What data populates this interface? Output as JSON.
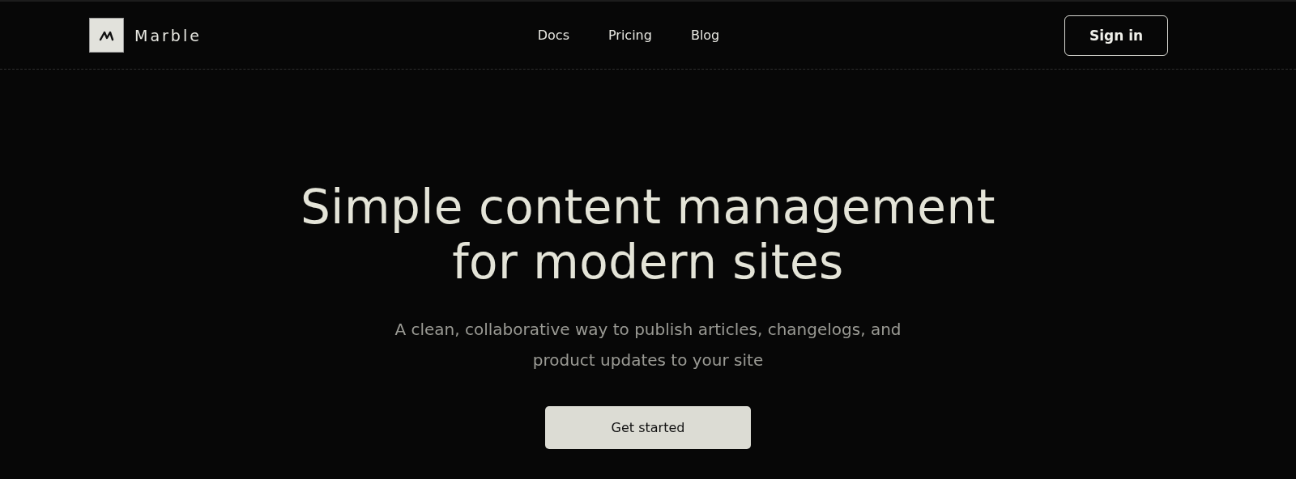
{
  "brand": {
    "name": "Marble"
  },
  "nav": [
    {
      "label": "Docs"
    },
    {
      "label": "Pricing"
    },
    {
      "label": "Blog"
    }
  ],
  "header_button": "Sign in",
  "hero": {
    "headline_lines": [
      "Simple content management",
      "for modern sites"
    ],
    "subtitle_lines": [
      "A clean, collaborative way to publish articles, changelogs, and",
      "product updates to your site"
    ],
    "cta": "Get started"
  }
}
